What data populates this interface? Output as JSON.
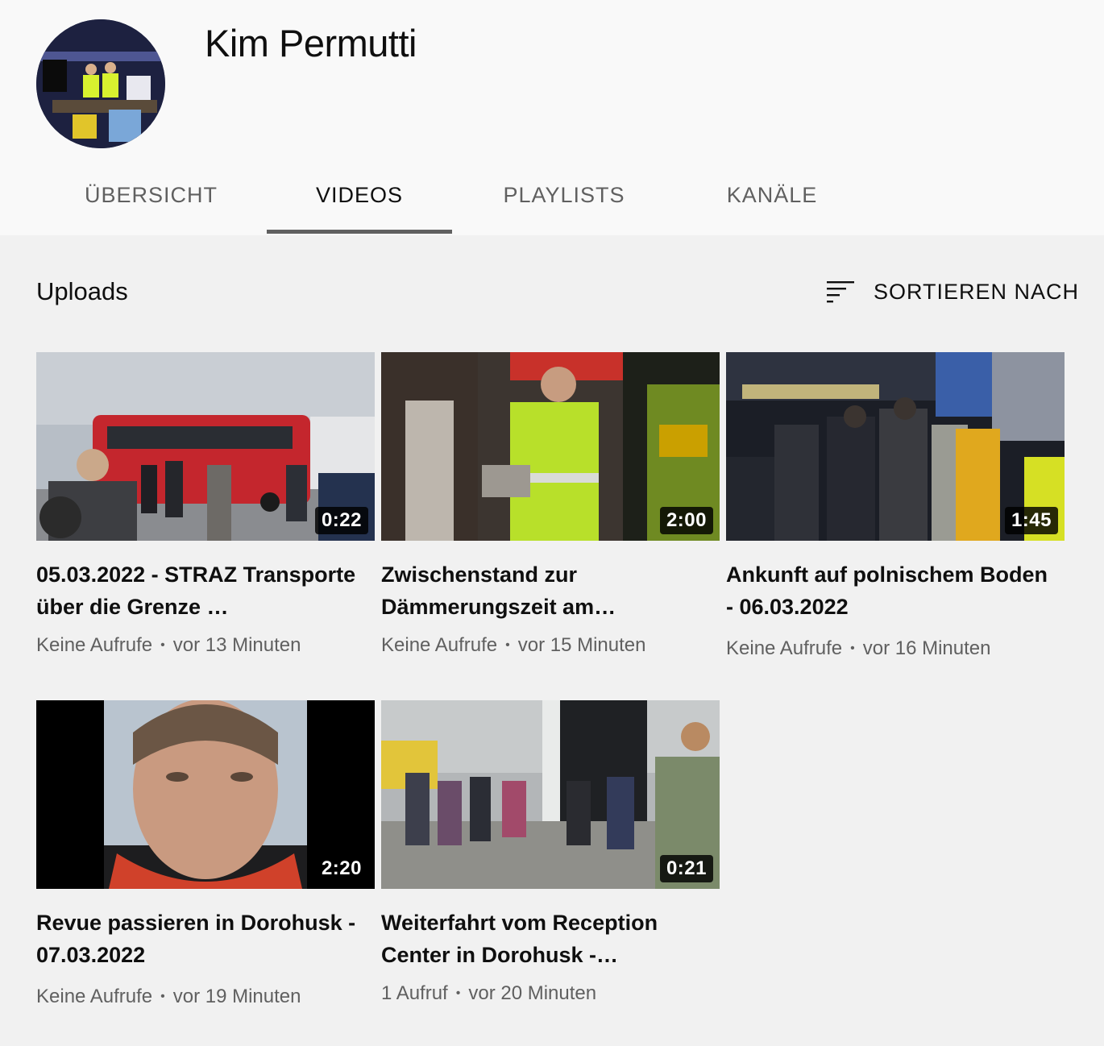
{
  "channel": {
    "name": "Kim Permutti"
  },
  "tabs": [
    {
      "label": "ÜBERSICHT"
    },
    {
      "label": "VIDEOS"
    },
    {
      "label": "PLAYLISTS"
    },
    {
      "label": "KANÄLE"
    }
  ],
  "active_tab": "VIDEOS",
  "section": {
    "title": "Uploads",
    "sort_label": "SORTIEREN NACH"
  },
  "videos": [
    {
      "title": "05.03.2022 - STRAZ Transporte über die Grenze …",
      "duration": "0:22",
      "views": "Keine Aufrufe",
      "age": "vor 13 Minuten"
    },
    {
      "title": "Zwischenstand zur Dämmerungszeit am…",
      "duration": "2:00",
      "views": "Keine Aufrufe",
      "age": "vor 15 Minuten"
    },
    {
      "title": "Ankunft auf polnischem Boden - 06.03.2022",
      "duration": "1:45",
      "views": "Keine Aufrufe",
      "age": "vor 16 Minuten"
    },
    {
      "title": "Revue passieren in Dorohusk - 07.03.2022",
      "duration": "2:20",
      "views": "Keine Aufrufe",
      "age": "vor 19 Minuten"
    },
    {
      "title": "Weiterfahrt vom Reception Center in Dorohusk -…",
      "duration": "0:21",
      "views": "1 Aufruf",
      "age": "vor 20 Minuten"
    }
  ],
  "colors": {
    "active_tab_underline": "#606060",
    "secondary_text": "#606060",
    "background": "#f1f1f1"
  }
}
